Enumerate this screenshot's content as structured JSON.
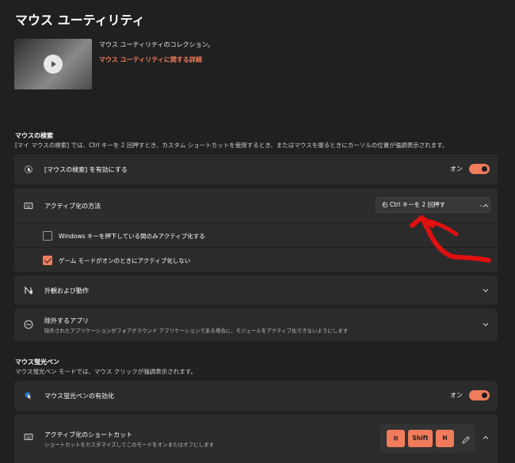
{
  "page": {
    "title": "マウス ユーティリティ",
    "intro_desc": "マウス ユーティリティのコレクション。",
    "intro_link": "マウス ユーティリティに関する詳細"
  },
  "find_mouse": {
    "section_title": "マウスの検索",
    "section_desc": "[マイ マウスの検索] では、Ctrl キーを 2 回押すとき、カスタム ショートカットを使用するとき、またはマウスを振るときにカーソルの位置が強調表示されます。",
    "enable_label": "[マウスの検索] を有効にする",
    "enable_state": "オン",
    "activation_label": "アクティブ化の方法",
    "activation_value": "右 Ctrl キーを 2 回押す",
    "option_windows_key": "Windows キーを押下している間のみアクティブ化する",
    "option_windows_key_checked": false,
    "option_game_mode": "ゲーム モードがオンのときにアクティブ化しない",
    "option_game_mode_checked": true,
    "appearance_label": "外観および動作",
    "excluded_apps_label": "除外するアプリ",
    "excluded_apps_desc": "除外されたアプリケーションがフォアグラウンド アプリケーションである場合に、モジュールをアクティブ化できないようにします"
  },
  "highlighter": {
    "section_title": "マウス蛍光ペン",
    "section_desc": "マウス蛍光ペン モードでは、マウス クリックが強調表示されます。",
    "enable_label": "マウス蛍光ペンの有効化",
    "enable_state": "オン",
    "shortcut_label": "アクティブ化のショートカット",
    "shortcut_desc": "ショートカットをカスタマイズしてこのモードをオンまたはオフにします",
    "keys": [
      "⊞",
      "Shift",
      "H"
    ]
  },
  "colors": {
    "accent": "#f07c5c",
    "background": "#202020",
    "card": "#2b2b2b",
    "annotation": "#e01010"
  },
  "icons": {
    "find_mouse": "pointer-icon",
    "activation": "keyboard-icon",
    "appearance": "appearance-icon",
    "excluded": "block-icon",
    "highlighter": "highlighter-icon",
    "shortcut": "keyboard-icon",
    "edit": "pencil-icon"
  }
}
